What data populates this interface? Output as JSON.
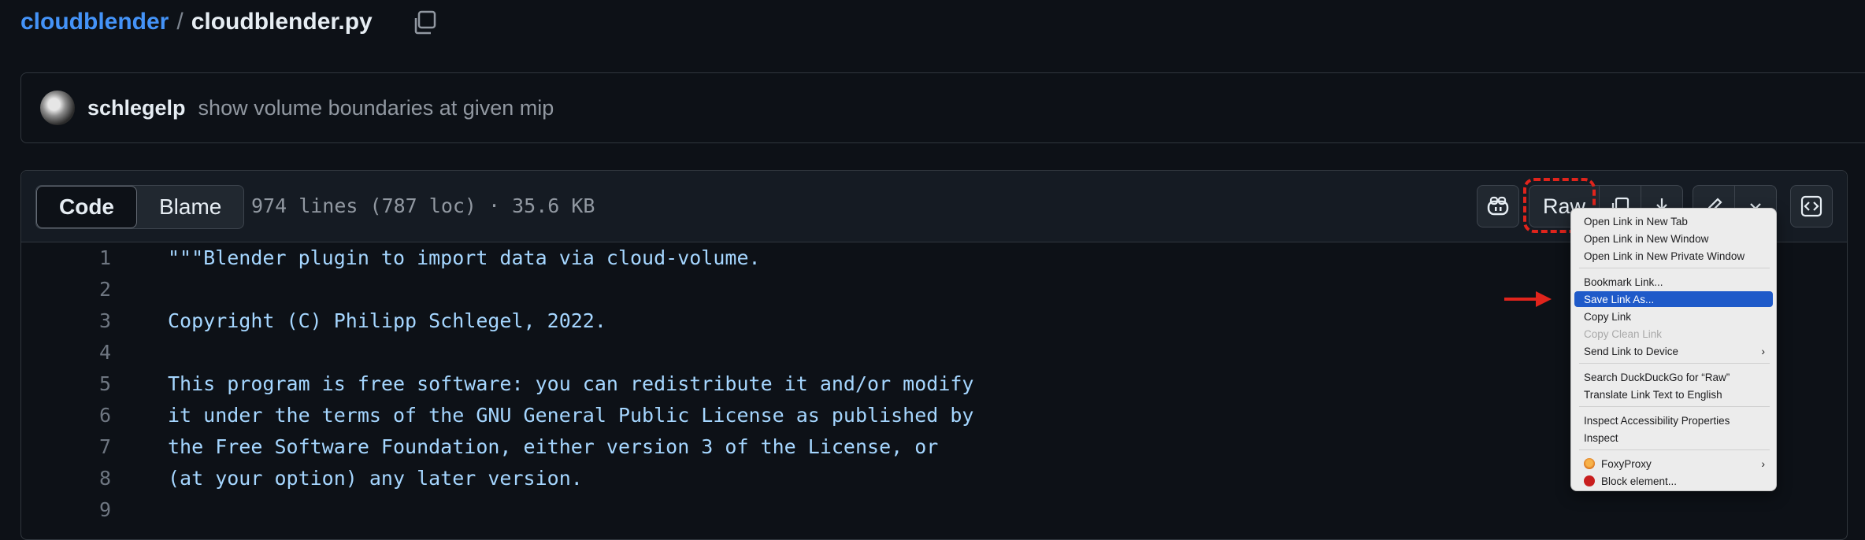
{
  "breadcrumb": {
    "repo": "cloudblender",
    "separator": "/",
    "file": "cloudblender.py"
  },
  "commit": {
    "author": "schlegelp",
    "message": "show volume boundaries at given mip"
  },
  "file_header": {
    "tabs": [
      {
        "label": "Code",
        "active": true
      },
      {
        "label": "Blame",
        "active": false
      }
    ],
    "meta": "974 lines (787 loc) · 35.6 KB",
    "raw_label": "Raw"
  },
  "code_lines": [
    {
      "n": "1",
      "text": "\"\"\"Blender plugin to import data via cloud-volume."
    },
    {
      "n": "2",
      "text": ""
    },
    {
      "n": "3",
      "text": "Copyright (C) Philipp Schlegel, 2022."
    },
    {
      "n": "4",
      "text": ""
    },
    {
      "n": "5",
      "text": "This program is free software: you can redistribute it and/or modify"
    },
    {
      "n": "6",
      "text": "it under the terms of the GNU General Public License as published by"
    },
    {
      "n": "7",
      "text": "the Free Software Foundation, either version 3 of the License, or"
    },
    {
      "n": "8",
      "text": "(at your option) any later version."
    },
    {
      "n": "9",
      "text": ""
    }
  ],
  "context_menu": {
    "items": [
      {
        "label": "Open Link in New Tab"
      },
      {
        "label": "Open Link in New Window"
      },
      {
        "label": "Open Link in New Private Window"
      },
      {
        "label": "Bookmark Link..."
      },
      {
        "label": "Save Link As...",
        "highlighted": true
      },
      {
        "label": "Copy Link"
      },
      {
        "label": "Copy Clean Link",
        "disabled": true
      },
      {
        "label": "Send Link to Device",
        "submenu": true
      },
      {
        "label": "Search DuckDuckGo for “Raw”"
      },
      {
        "label": "Translate Link Text to English"
      },
      {
        "label": "Inspect Accessibility Properties"
      },
      {
        "label": "Inspect"
      },
      {
        "label": "FoxyProxy",
        "submenu": true,
        "icon": "foxyproxy-icon"
      },
      {
        "label": "Block element...",
        "icon": "block-element-icon"
      }
    ]
  },
  "colors": {
    "accent": "#4493f8",
    "page_bg": "#0d1117",
    "code_text": "#a5d6ff",
    "menu_highlight": "#1f5ac9",
    "annotation_red": "#e0241c"
  }
}
